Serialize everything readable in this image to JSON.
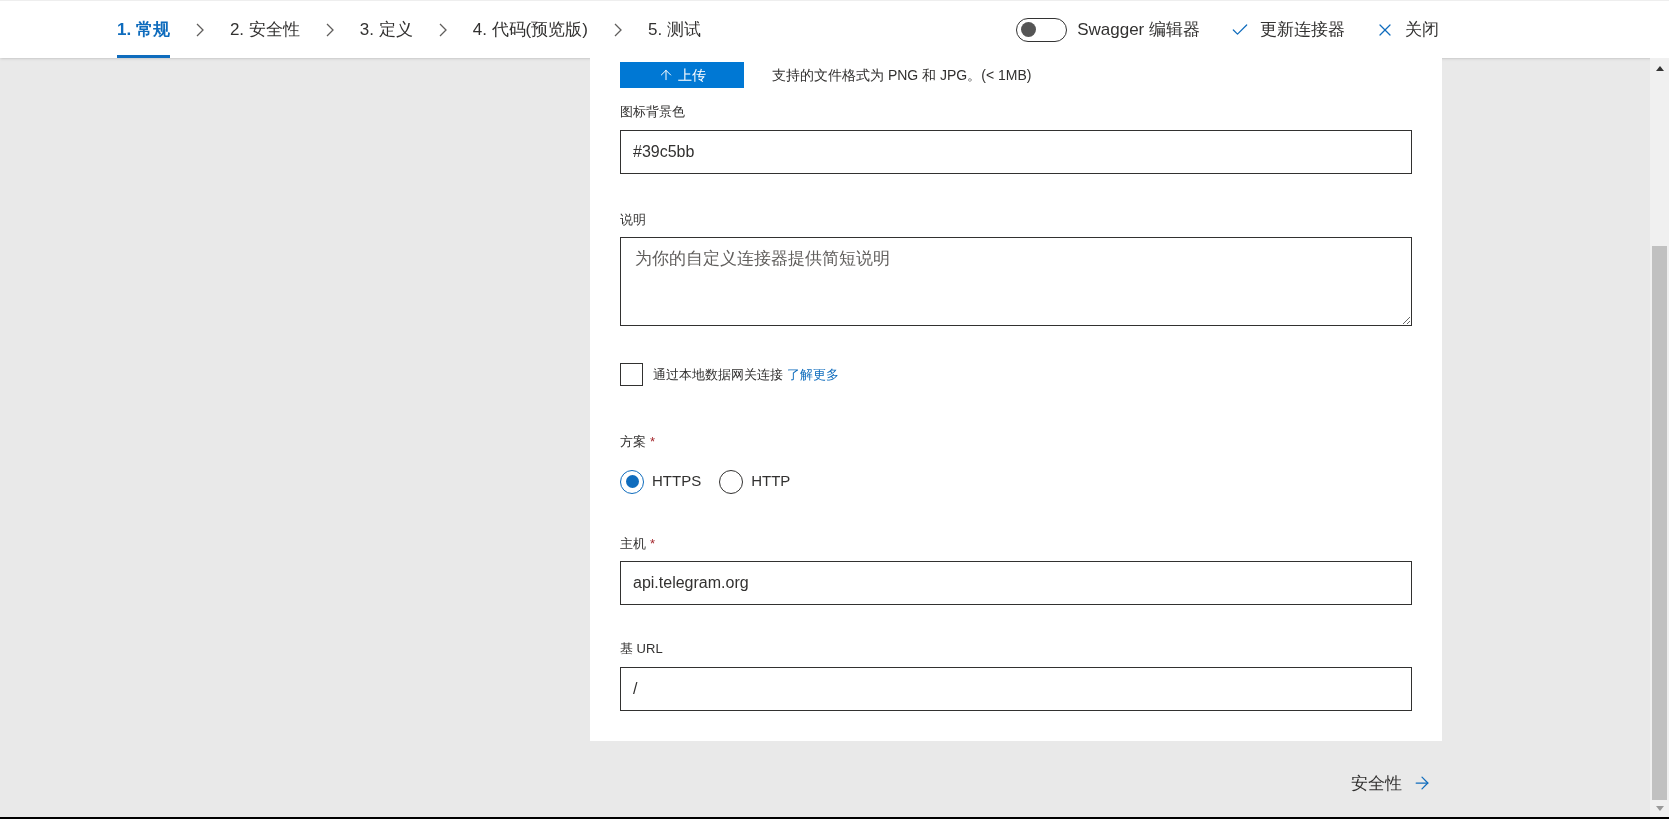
{
  "steps": [
    {
      "label": "1. 常规",
      "selected": true
    },
    {
      "label": "2. 安全性",
      "selected": false
    },
    {
      "label": "3. 定义",
      "selected": false
    },
    {
      "label": "4. 代码(预览版)",
      "selected": false
    },
    {
      "label": "5. 测试",
      "selected": false
    }
  ],
  "swagger_toggle": {
    "label": "Swagger 编辑器",
    "on": false
  },
  "actions": [
    {
      "label": "更新连接器",
      "kind": "check"
    },
    {
      "label": "关闭",
      "kind": "close"
    }
  ],
  "upload": {
    "button": "上传",
    "hint": "支持的文件格式为 PNG 和 JPG。(< 1MB)"
  },
  "icon_color": {
    "label": "图标背景色",
    "value": "#39c5bb"
  },
  "description": {
    "label": "说明",
    "placeholder": "为你的自定义连接器提供简短说明"
  },
  "gateway": {
    "label": "通过本地数据网关连接",
    "link": "了解更多",
    "checked": false
  },
  "scheme": {
    "label": "方案",
    "required_mark": "*",
    "options": [
      {
        "label": "HTTPS",
        "selected": true
      },
      {
        "label": "HTTP",
        "selected": false
      }
    ]
  },
  "host": {
    "label": "主机",
    "required_mark": "*",
    "value": "api.telegram.org"
  },
  "base_url": {
    "label": "基 URL",
    "value": "/"
  },
  "next": {
    "label": "安全性"
  }
}
